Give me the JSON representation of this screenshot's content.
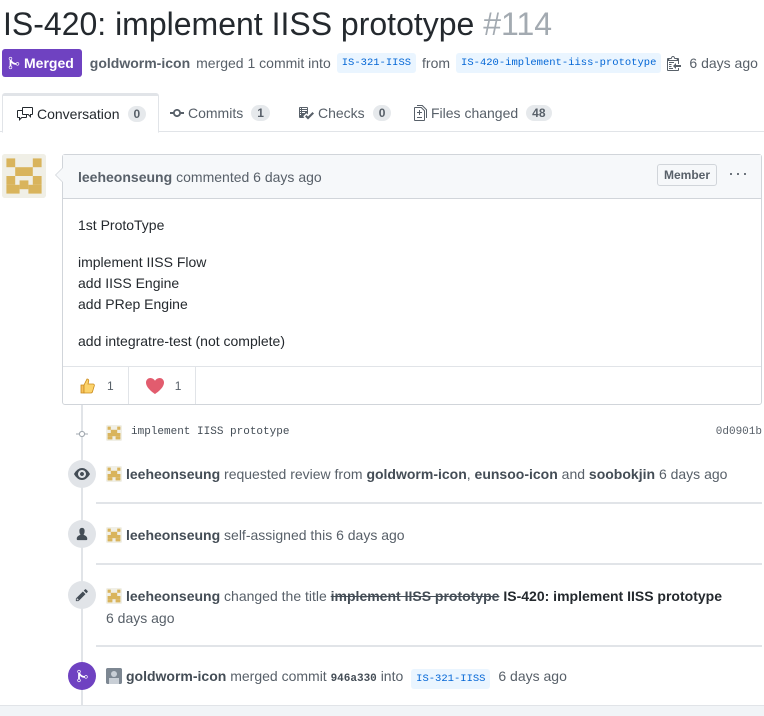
{
  "pr": {
    "title": "IS-420: implement IISS prototype",
    "number": "#114",
    "state": "Merged",
    "author": "goldworm-icon",
    "merged_text": "merged 1 commit into",
    "base_branch": "IS-321-IISS",
    "from_text": "from",
    "head_branch": "IS-420-implement-iiss-prototype",
    "time": "6 days ago"
  },
  "tabs": [
    {
      "label": "Conversation",
      "count": "0",
      "icon": "comment-discussion-icon"
    },
    {
      "label": "Commits",
      "count": "1",
      "icon": "git-commit-icon"
    },
    {
      "label": "Checks",
      "count": "0",
      "icon": "checklist-icon"
    },
    {
      "label": "Files changed",
      "count": "48",
      "icon": "file-diff-icon"
    }
  ],
  "comment": {
    "author": "leeheonseung",
    "action": "commented 6 days ago",
    "badge": "Member",
    "body": {
      "p1": "1st ProtoType",
      "l1": "implement IISS Flow",
      "l2": "add IISS Engine",
      "l3": "add PRep Engine",
      "p3": "add integratre-test (not complete)"
    },
    "reactions": [
      {
        "icon": "thumbs-up-icon",
        "count": "1"
      },
      {
        "icon": "heart-icon",
        "count": "1"
      }
    ]
  },
  "timeline": {
    "commit": {
      "message": "implement IISS prototype",
      "sha": "0d0901b"
    },
    "review": {
      "actor": "leeheonseung",
      "text1": "requested review from",
      "r1": "goldworm-icon",
      "comma": ",",
      "r2": "eunsoo-icon",
      "and": "and",
      "r3": "soobokjin",
      "time": "6 days ago"
    },
    "assign": {
      "actor": "leeheonseung",
      "text": "self-assigned this",
      "time": "6 days ago"
    },
    "rename": {
      "actor": "leeheonseung",
      "text": "changed the title",
      "old": "implement IISS prototype",
      "new": "IS-420: implement IISS prototype",
      "time": "6 days ago"
    },
    "merge": {
      "actor": "goldworm-icon",
      "text": "merged commit",
      "sha": "946a330",
      "into": "into",
      "branch": "IS-321-IISS",
      "time": "6 days ago"
    }
  },
  "colors": {
    "merged": "#6f42c1",
    "link": "#0366d6",
    "muted": "#586069"
  }
}
